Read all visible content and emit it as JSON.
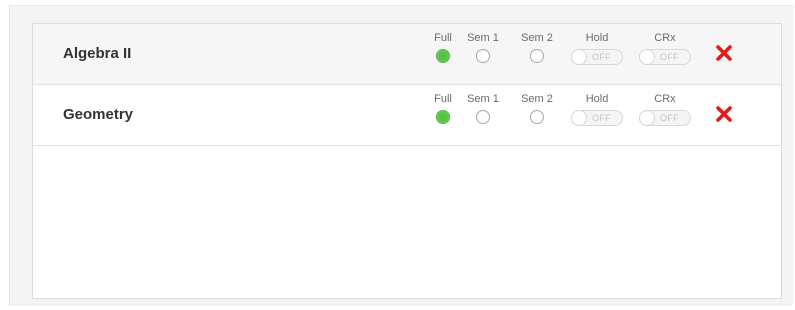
{
  "colors": {
    "checked_radio": "#4fc43d",
    "delete_icon": "#e81818",
    "row_shade": "#f6f6f6"
  },
  "courses": [
    {
      "name": "Algebra II",
      "options": {
        "full_label": "Full",
        "sem1_label": "Sem 1",
        "sem2_label": "Sem 2",
        "hold_label": "Hold",
        "crx_label": "CRx",
        "selected": "Full",
        "hold_state": "OFF",
        "crx_state": "OFF"
      },
      "delete_icon": "delete-x-icon"
    },
    {
      "name": "Geometry",
      "options": {
        "full_label": "Full",
        "sem1_label": "Sem 1",
        "sem2_label": "Sem 2",
        "hold_label": "Hold",
        "crx_label": "CRx",
        "selected": "Full",
        "hold_state": "OFF",
        "crx_state": "OFF"
      },
      "delete_icon": "delete-x-icon"
    }
  ]
}
